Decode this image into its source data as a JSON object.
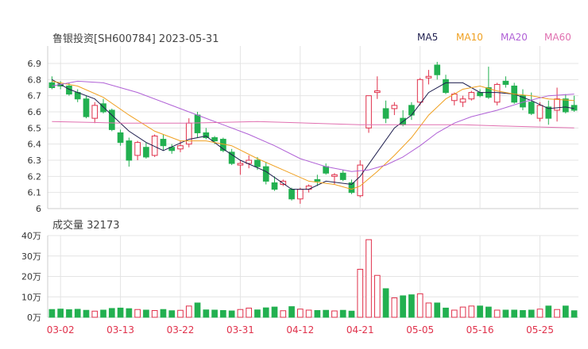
{
  "header": {
    "stock_title": "鲁银投资[SH600784] 2023-05-31",
    "volume_title": "成交量 32173"
  },
  "legend": [
    {
      "label": "MA5",
      "color": "#1f1f4f"
    },
    {
      "label": "MA10",
      "color": "#f0a020"
    },
    {
      "label": "MA20",
      "color": "#b061d6"
    },
    {
      "label": "MA60",
      "color": "#e070b0"
    }
  ],
  "colors": {
    "up": "#e0314b",
    "down": "#22b050",
    "grid": "#e4e4e4",
    "axis": "#cccccc",
    "date_label": "#e0314b"
  },
  "chart_data": [
    {
      "type": "candlestick",
      "title": "鲁银投资[SH600784] 2023-05-31",
      "ylim": [
        6.0,
        6.9
      ],
      "yticks": [
        "6",
        "6.1",
        "6.2",
        "6.3",
        "6.4",
        "6.5",
        "6.6",
        "6.7",
        "6.8",
        "6.9"
      ],
      "grid": true,
      "dates": [
        "03-01",
        "03-02",
        "03-03",
        "03-06",
        "03-07",
        "03-08",
        "03-09",
        "03-10",
        "03-13",
        "03-14",
        "03-15",
        "03-16",
        "03-17",
        "03-20",
        "03-21",
        "03-22",
        "03-23",
        "03-24",
        "03-27",
        "03-28",
        "03-29",
        "03-30",
        "03-31",
        "04-03",
        "04-04",
        "04-06",
        "04-07",
        "04-10",
        "04-11",
        "04-12",
        "04-13",
        "04-14",
        "04-17",
        "04-18",
        "04-19",
        "04-20",
        "04-21",
        "04-24",
        "04-25",
        "04-26",
        "04-27",
        "04-28",
        "05-04",
        "05-05",
        "05-08",
        "05-09",
        "05-10",
        "05-11",
        "05-12",
        "05-15",
        "05-16",
        "05-17",
        "05-18",
        "05-19",
        "05-22",
        "05-23",
        "05-24",
        "05-25",
        "05-26",
        "05-29",
        "05-30",
        "05-31"
      ],
      "xtick_labels": [
        "03-02",
        "03-13",
        "03-22",
        "03-31",
        "04-12",
        "04-21",
        "05-05",
        "05-16",
        "05-25"
      ],
      "ohlc": [
        [
          6.78,
          6.82,
          6.74,
          6.75
        ],
        [
          6.77,
          6.79,
          6.74,
          6.76
        ],
        [
          6.76,
          6.78,
          6.7,
          6.71
        ],
        [
          6.72,
          6.74,
          6.66,
          6.68
        ],
        [
          6.68,
          6.7,
          6.56,
          6.57
        ],
        [
          6.56,
          6.66,
          6.53,
          6.64
        ],
        [
          6.65,
          6.68,
          6.59,
          6.6
        ],
        [
          6.61,
          6.62,
          6.48,
          6.49
        ],
        [
          6.47,
          6.49,
          6.39,
          6.41
        ],
        [
          6.42,
          6.44,
          6.26,
          6.3
        ],
        [
          6.33,
          6.42,
          6.3,
          6.41
        ],
        [
          6.38,
          6.41,
          6.31,
          6.32
        ],
        [
          6.33,
          6.46,
          6.32,
          6.45
        ],
        [
          6.43,
          6.46,
          6.36,
          6.39
        ],
        [
          6.38,
          6.4,
          6.34,
          6.36
        ],
        [
          6.37,
          6.42,
          6.35,
          6.39
        ],
        [
          6.4,
          6.56,
          6.38,
          6.53
        ],
        [
          6.58,
          6.6,
          6.44,
          6.47
        ],
        [
          6.47,
          6.5,
          6.43,
          6.44
        ],
        [
          6.44,
          6.45,
          6.4,
          6.42
        ],
        [
          6.43,
          6.44,
          6.35,
          6.36
        ],
        [
          6.35,
          6.37,
          6.27,
          6.28
        ],
        [
          6.27,
          6.3,
          6.21,
          6.28
        ],
        [
          6.28,
          6.33,
          6.25,
          6.3
        ],
        [
          6.3,
          6.32,
          6.24,
          6.26
        ],
        [
          6.26,
          6.29,
          6.15,
          6.17
        ],
        [
          6.16,
          6.2,
          6.11,
          6.12
        ],
        [
          6.15,
          6.18,
          6.14,
          6.17
        ],
        [
          6.12,
          6.13,
          6.05,
          6.06
        ],
        [
          6.06,
          6.13,
          6.03,
          6.12
        ],
        [
          6.12,
          6.15,
          6.1,
          6.14
        ],
        [
          6.18,
          6.21,
          6.14,
          6.17
        ],
        [
          6.26,
          6.28,
          6.21,
          6.22
        ],
        [
          6.2,
          6.22,
          6.15,
          6.21
        ],
        [
          6.22,
          6.24,
          6.17,
          6.18
        ],
        [
          6.16,
          6.18,
          6.09,
          6.1
        ],
        [
          6.08,
          6.3,
          6.07,
          6.27
        ],
        [
          6.5,
          6.65,
          6.47,
          6.7
        ],
        [
          6.72,
          6.82,
          6.68,
          6.73
        ],
        [
          6.62,
          6.67,
          6.53,
          6.56
        ],
        [
          6.62,
          6.66,
          6.58,
          6.64
        ],
        [
          6.56,
          6.61,
          6.51,
          6.52
        ],
        [
          6.64,
          6.66,
          6.55,
          6.58
        ],
        [
          6.66,
          6.81,
          6.64,
          6.8
        ],
        [
          6.81,
          6.86,
          6.77,
          6.82
        ],
        [
          6.89,
          6.91,
          6.8,
          6.83
        ],
        [
          6.8,
          6.83,
          6.71,
          6.72
        ],
        [
          6.67,
          6.72,
          6.64,
          6.71
        ],
        [
          6.66,
          6.7,
          6.63,
          6.68
        ],
        [
          6.68,
          6.73,
          6.67,
          6.72
        ],
        [
          6.72,
          6.74,
          6.69,
          6.7
        ],
        [
          6.75,
          6.88,
          6.68,
          6.69
        ],
        [
          6.66,
          6.78,
          6.64,
          6.77
        ],
        [
          6.79,
          6.82,
          6.75,
          6.77
        ],
        [
          6.76,
          6.78,
          6.65,
          6.66
        ],
        [
          6.7,
          6.74,
          6.61,
          6.63
        ],
        [
          6.66,
          6.72,
          6.58,
          6.59
        ],
        [
          6.56,
          6.66,
          6.54,
          6.64
        ],
        [
          6.63,
          6.67,
          6.52,
          6.56
        ],
        [
          6.61,
          6.75,
          6.54,
          6.68
        ],
        [
          6.68,
          6.71,
          6.59,
          6.6
        ],
        [
          6.64,
          6.7,
          6.6,
          6.61
        ]
      ],
      "ma": {
        "MA5": [
          [
            0,
            6.8
          ],
          [
            2,
            6.74
          ],
          [
            5,
            6.68
          ],
          [
            7,
            6.58
          ],
          [
            9,
            6.48
          ],
          [
            11,
            6.41
          ],
          [
            13,
            6.36
          ],
          [
            16,
            6.43
          ],
          [
            18,
            6.45
          ],
          [
            20,
            6.37
          ],
          [
            22,
            6.3
          ],
          [
            25,
            6.23
          ],
          [
            28,
            6.12
          ],
          [
            30,
            6.12
          ],
          [
            32,
            6.17
          ],
          [
            35,
            6.15
          ],
          [
            36,
            6.2
          ],
          [
            38,
            6.35
          ],
          [
            40,
            6.5
          ],
          [
            42,
            6.58
          ],
          [
            44,
            6.72
          ],
          [
            46,
            6.78
          ],
          [
            48,
            6.78
          ],
          [
            50,
            6.72
          ],
          [
            52,
            6.72
          ],
          [
            54,
            6.71
          ],
          [
            56,
            6.67
          ],
          [
            58,
            6.62
          ],
          [
            60,
            6.63
          ],
          [
            61,
            6.62
          ]
        ],
        "MA10": [
          [
            0,
            6.79
          ],
          [
            3,
            6.76
          ],
          [
            6,
            6.69
          ],
          [
            9,
            6.58
          ],
          [
            12,
            6.48
          ],
          [
            15,
            6.42
          ],
          [
            18,
            6.42
          ],
          [
            21,
            6.39
          ],
          [
            24,
            6.31
          ],
          [
            27,
            6.24
          ],
          [
            30,
            6.17
          ],
          [
            33,
            6.15
          ],
          [
            35,
            6.12
          ],
          [
            36,
            6.14
          ],
          [
            38,
            6.23
          ],
          [
            40,
            6.33
          ],
          [
            42,
            6.44
          ],
          [
            44,
            6.58
          ],
          [
            46,
            6.68
          ],
          [
            48,
            6.74
          ],
          [
            50,
            6.76
          ],
          [
            52,
            6.73
          ],
          [
            54,
            6.71
          ],
          [
            56,
            6.7
          ],
          [
            58,
            6.68
          ],
          [
            61,
            6.67
          ]
        ],
        "MA20": [
          [
            0,
            6.76
          ],
          [
            3,
            6.79
          ],
          [
            6,
            6.78
          ],
          [
            10,
            6.72
          ],
          [
            14,
            6.64
          ],
          [
            17,
            6.58
          ],
          [
            20,
            6.52
          ],
          [
            23,
            6.46
          ],
          [
            26,
            6.39
          ],
          [
            29,
            6.31
          ],
          [
            32,
            6.26
          ],
          [
            35,
            6.23
          ],
          [
            37,
            6.24
          ],
          [
            39,
            6.27
          ],
          [
            41,
            6.32
          ],
          [
            43,
            6.39
          ],
          [
            45,
            6.47
          ],
          [
            47,
            6.53
          ],
          [
            49,
            6.57
          ],
          [
            52,
            6.61
          ],
          [
            55,
            6.66
          ],
          [
            58,
            6.7
          ],
          [
            61,
            6.71
          ]
        ],
        "MA60": [
          [
            0,
            6.54
          ],
          [
            8,
            6.53
          ],
          [
            16,
            6.53
          ],
          [
            24,
            6.54
          ],
          [
            30,
            6.53
          ],
          [
            36,
            6.52
          ],
          [
            42,
            6.52
          ],
          [
            48,
            6.52
          ],
          [
            54,
            6.51
          ],
          [
            61,
            6.5
          ]
        ]
      }
    },
    {
      "type": "bar",
      "title": "成交量 32173",
      "ylim": [
        0,
        40
      ],
      "yticks": [
        "0万",
        "10万",
        "20万",
        "30万",
        "40万"
      ],
      "values": [
        3.8,
        4.0,
        3.7,
        3.9,
        3.4,
        3.0,
        3.5,
        4.3,
        4.5,
        4.2,
        3.8,
        3.5,
        3.3,
        3.8,
        3.2,
        3.4,
        5.5,
        7.0,
        3.6,
        3.5,
        3.3,
        3.1,
        3.8,
        4.5,
        3.6,
        4.6,
        5.0,
        3.2,
        5.2,
        4.0,
        3.5,
        3.3,
        3.4,
        3.1,
        3.4,
        3.0,
        23.5,
        38.0,
        20.5,
        14.0,
        9.5,
        10.5,
        11.0,
        11.5,
        7.0,
        7.0,
        4.5,
        3.5,
        5.0,
        5.5,
        5.5,
        5.0,
        3.5,
        3.5,
        3.5,
        3.3,
        3.5,
        4.0,
        5.5,
        3.8,
        5.5,
        3.2
      ]
    }
  ]
}
